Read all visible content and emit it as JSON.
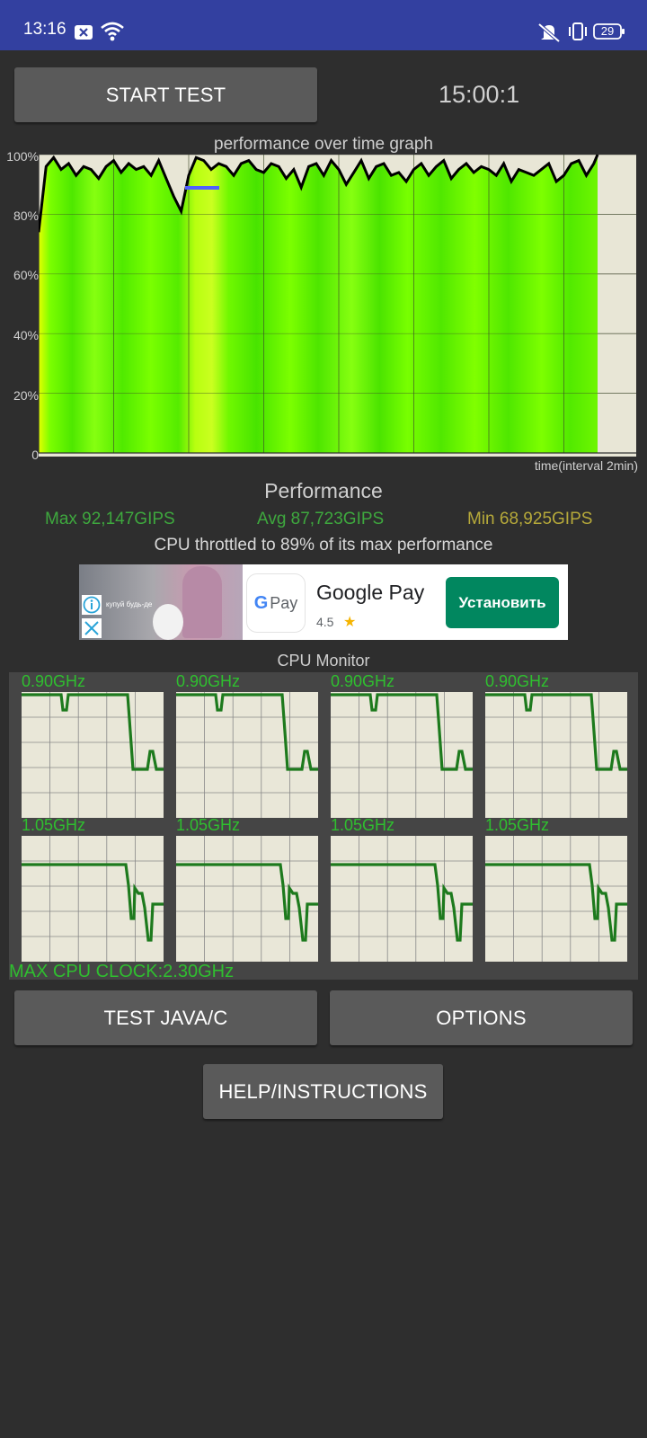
{
  "status_bar": {
    "time": "13:16",
    "battery": "29"
  },
  "controls": {
    "start_label": "START TEST",
    "timer": "15:00:1"
  },
  "graph": {
    "title": "performance over time graph",
    "y_ticks": [
      "100%",
      "80%",
      "60%",
      "40%",
      "20%",
      "0"
    ],
    "time_label": "time(interval 2min)"
  },
  "performance": {
    "title": "Performance",
    "max": "Max 92,147GIPS",
    "avg": "Avg 87,723GIPS",
    "min": "Min 68,925GIPS",
    "throttle": "CPU throttled to 89% of its max performance",
    "colors": {
      "max": "#3ea83e",
      "avg": "#3ea83e",
      "min": "#b6a93a"
    }
  },
  "ad": {
    "image_text": "купуй будь-де",
    "app_name": "Google Pay",
    "rating": "4.5",
    "cta": "Установить",
    "logo_text": "Pay"
  },
  "cpu_monitor": {
    "title": "CPU Monitor",
    "cores": [
      {
        "freq": "0.90GHz"
      },
      {
        "freq": "0.90GHz"
      },
      {
        "freq": "0.90GHz"
      },
      {
        "freq": "0.90GHz"
      },
      {
        "freq": "1.05GHz"
      },
      {
        "freq": "1.05GHz"
      },
      {
        "freq": "1.05GHz"
      },
      {
        "freq": "1.05GHz"
      }
    ],
    "max_clock": "MAX CPU CLOCK:2.30GHz"
  },
  "buttons": {
    "test_java": "TEST JAVA/C",
    "options": "OPTIONS",
    "help": "HELP/INSTRUCTIONS"
  },
  "chart_data": {
    "type": "area",
    "title": "performance over time graph",
    "xlabel": "time(interval 2min)",
    "ylabel": "",
    "ylim": [
      0,
      100
    ],
    "y_ticks": [
      "0",
      "20%",
      "40%",
      "60%",
      "80%",
      "100%"
    ],
    "x_range_minutes": [
      0,
      14.9
    ],
    "series": [
      {
        "x": [
          0,
          0.2,
          0.4,
          0.6,
          0.8,
          1.0,
          1.2,
          1.4,
          1.6,
          1.8,
          2.0,
          2.2,
          2.4,
          2.6,
          2.8,
          3.0,
          3.2,
          3.4,
          3.6,
          3.8,
          4.0,
          4.2,
          4.4,
          4.6,
          4.8,
          5.0,
          5.2,
          5.4,
          5.6,
          5.8,
          6.0,
          6.2,
          6.4,
          6.6,
          6.8,
          7.0,
          7.2,
          7.4,
          7.6,
          7.8,
          8.0,
          8.2,
          8.4,
          8.6,
          8.8,
          9.0,
          9.2,
          9.4,
          9.6,
          9.8,
          10.0,
          10.2,
          10.4,
          10.6,
          10.8,
          11.0,
          11.2,
          11.4,
          11.6,
          11.8,
          12.0,
          12.2,
          12.4,
          12.6,
          12.8,
          13.0,
          13.2,
          13.4,
          13.6,
          13.8,
          14.0,
          14.2,
          14.4,
          14.6,
          14.8,
          14.9
        ],
        "values": [
          74,
          96,
          99,
          95,
          97,
          93,
          96,
          95,
          92,
          96,
          98,
          94,
          97,
          95,
          96,
          93,
          98,
          92,
          86,
          81,
          93,
          99,
          98,
          95,
          97,
          96,
          93,
          97,
          98,
          95,
          94,
          97,
          96,
          92,
          95,
          89,
          96,
          97,
          93,
          98,
          95,
          90,
          94,
          98,
          92,
          96,
          97,
          93,
          94,
          91,
          95,
          97,
          93,
          96,
          98,
          92,
          95,
          97,
          94,
          96,
          95,
          93,
          97,
          91,
          95,
          94,
          93,
          95,
          97,
          91,
          93,
          97,
          98,
          93,
          97,
          100
        ]
      }
    ]
  }
}
